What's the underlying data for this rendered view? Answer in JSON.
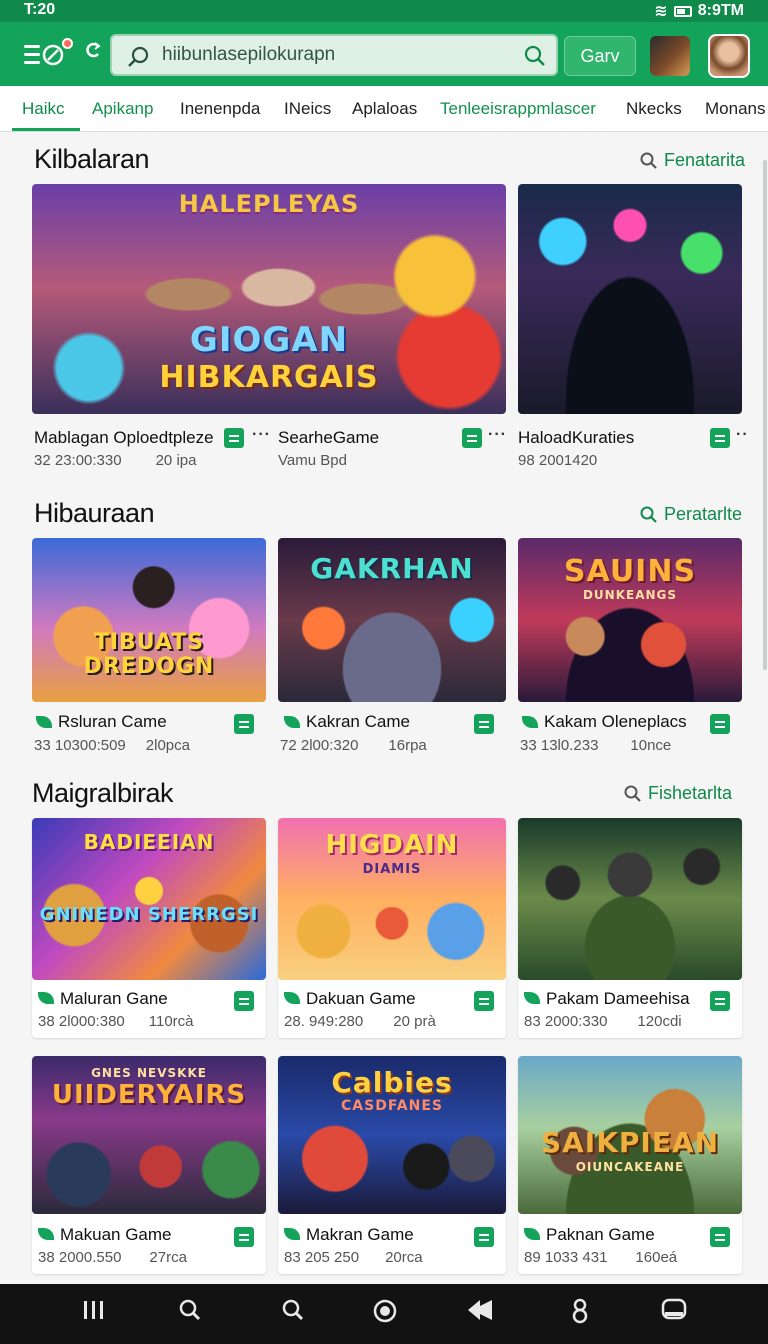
{
  "status": {
    "time": "T:20",
    "clock_right": "8:9TM"
  },
  "header": {
    "search_placeholder": "hiibunlasepilokurapn",
    "go_label": "Garv"
  },
  "tabs": [
    {
      "label": "Haikc"
    },
    {
      "label": "Apikanp"
    },
    {
      "label": "Inenenpda"
    },
    {
      "label": "INeics"
    },
    {
      "label": "Aplaloas"
    },
    {
      "label": "Tenleeisrappmlascer"
    },
    {
      "label": "Nkecks"
    },
    {
      "label": "Monans"
    }
  ],
  "sections": [
    {
      "title": "Kilbalaran",
      "link": "Fenatarita",
      "cards": [
        {
          "caption_top": "HALEPLEYAS",
          "caption": "GIOGAN",
          "caption2": "HIBKARGAIS",
          "title": "Mablagan Oploedtpleze",
          "meta1": "32 23:00:330",
          "meta2": "20 ipa"
        },
        {
          "caption": "",
          "title": "SearheGame",
          "meta1": "Vamu Bpd",
          "meta2": ""
        },
        {
          "caption": "",
          "title": "HaloadKuraties",
          "meta1": "98 2001420",
          "meta2": ""
        }
      ]
    },
    {
      "title": "Hibauraan",
      "link": "Peratarlte",
      "cards": [
        {
          "caption": "TIBUATS",
          "caption2": "DREDOGN",
          "title": "Rsluran Came",
          "meta1": "33 10300:509",
          "meta2": "2l0pca"
        },
        {
          "caption": "GAKRHAN",
          "caption2": "",
          "title": "Kakran Came",
          "meta1": "72 2l00:320",
          "meta2": "16rpa"
        },
        {
          "caption": "SAUINS",
          "caption2": "DUNKEANGS",
          "title": "Kakam Oleneplacs",
          "meta1": "33 13l0.233",
          "meta2": "10nce"
        }
      ]
    },
    {
      "title": "Maigralbirak",
      "link": "Fishetarlta",
      "cards": [
        {
          "caption": "BADIEEIAN",
          "caption2": "GNINEDN SHERRGSI",
          "title": "Maluran Gane",
          "meta1": "38 2l000:380",
          "meta2": "110rcà"
        },
        {
          "caption": "HIGDAIN",
          "caption2": "DIAMIS",
          "title": "Dakuan Game",
          "meta1": "28. 949:280",
          "meta2": "20 prà"
        },
        {
          "caption": "",
          "caption2": "",
          "title": "Pakam Dameehisa",
          "meta1": "83 2000:330",
          "meta2": "120cdi"
        }
      ]
    },
    {
      "title": "",
      "link": "",
      "cards": [
        {
          "caption": "GNES NEVSKKE",
          "caption2": "UIIDERYAIRS",
          "title": "Makuan Game",
          "meta1": "38 2000.550",
          "meta2": "27rca"
        },
        {
          "caption": "Calbies",
          "caption2": "CASDFANES",
          "title": "Makran Game",
          "meta1": "83 205 250",
          "meta2": "20rca"
        },
        {
          "caption": "SAIKPIEAN",
          "caption2": "OIUNCAKEANE",
          "title": "Paknan Game",
          "meta1": "89 1033 431",
          "meta2": "160eá"
        }
      ]
    }
  ],
  "colors": {
    "brand": "#14a35a",
    "brand_dark": "#0f8a4a",
    "nav_bg": "#121212"
  }
}
